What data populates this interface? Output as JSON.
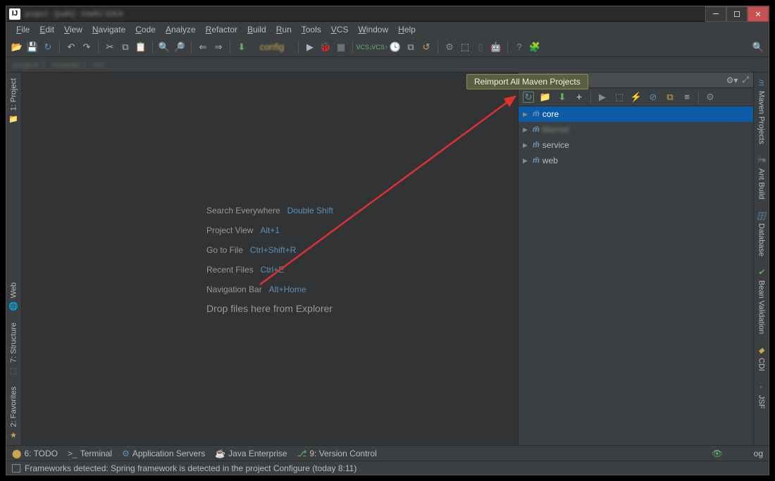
{
  "titlebar": {
    "app_abbr": "IJ",
    "title": "project - [path] - IntelliJ IDEA"
  },
  "menu": [
    "File",
    "Edit",
    "View",
    "Navigate",
    "Code",
    "Analyze",
    "Refactor",
    "Build",
    "Run",
    "Tools",
    "VCS",
    "Window",
    "Help"
  ],
  "breadcrumb": [
    "project",
    "module",
    "src/main"
  ],
  "tooltip": "Reimport All Maven Projects",
  "welcome": {
    "lines": [
      {
        "label": "Search Everywhere",
        "shortcut": "Double Shift"
      },
      {
        "label": "Project View",
        "shortcut": "Alt+1"
      },
      {
        "label": "Go to File",
        "shortcut": "Ctrl+Shift+R"
      },
      {
        "label": "Recent Files",
        "shortcut": "Ctrl+E"
      },
      {
        "label": "Navigation Bar",
        "shortcut": "Alt+Home"
      }
    ],
    "drop": "Drop files here from Explorer"
  },
  "maven_tree": [
    {
      "label": "core",
      "selected": true
    },
    {
      "label": "blurred",
      "blur": true
    },
    {
      "label": "service"
    },
    {
      "label": "web"
    }
  ],
  "left_tabs": [
    "1: Project",
    "Web",
    "7: Structure",
    "2: Favorites"
  ],
  "right_tabs": [
    "Maven Projects",
    "Ant Build",
    "Database",
    "Bean Validation",
    "CDI",
    "JSF"
  ],
  "bottom_tabs": [
    {
      "icon": "⬤",
      "color": "#c9a54d",
      "label": "6: TODO"
    },
    {
      "icon": ">_",
      "color": "#aaa",
      "label": "Terminal"
    },
    {
      "icon": "⚙",
      "color": "#5891bf",
      "label": "Application Servers"
    },
    {
      "icon": "☕",
      "color": "#c9a54d",
      "label": "Java Enterprise"
    },
    {
      "icon": "⎇",
      "color": "#62b767",
      "label": "9: Version Control"
    }
  ],
  "bottom_right": "og",
  "status": "Frameworks detected: Spring framework is detected in the project Configure (today 8:11)"
}
